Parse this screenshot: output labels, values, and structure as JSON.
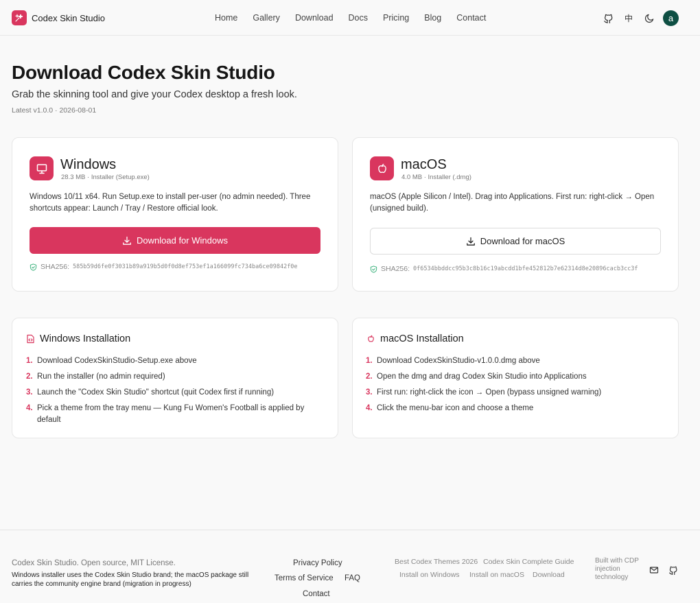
{
  "brand": {
    "name": "Codex Skin Studio"
  },
  "nav": {
    "items": [
      "Home",
      "Gallery",
      "Download",
      "Docs",
      "Pricing",
      "Blog",
      "Contact"
    ]
  },
  "header": {
    "lang_label": "中",
    "avatar_letter": "a"
  },
  "hero": {
    "title": "Download Codex Skin Studio",
    "subtitle": "Grab the skinning tool and give your Codex desktop a fresh look.",
    "latest": "Latest v1.0.0 · 2026-08-01"
  },
  "windows": {
    "name": "Windows",
    "meta": "28.3 MB · Installer (Setup.exe)",
    "desc": "Windows 10/11 x64. Run Setup.exe to install per-user (no admin needed). Three shortcuts appear: Launch / Tray / Restore official look.",
    "button": "Download for Windows",
    "sha_label": "SHA256:",
    "sha_value": "585b59d6fe0f3031b89a919b5d0f0d8ef753ef1a166099fc734ba6ce09842f0e"
  },
  "macos": {
    "name": "macOS",
    "meta": "4.0 MB · Installer (.dmg)",
    "desc": "macOS (Apple Silicon / Intel). Drag into Applications. First run: right-click → Open (unsigned build).",
    "button": "Download for macOS",
    "sha_label": "SHA256:",
    "sha_value": "0f6534bbddcc95b3c8b16c19abcdd1bfe452812b7e62314d8e20896cacb3cc3f"
  },
  "win_install": {
    "title": "Windows Installation",
    "steps": [
      {
        "num": "1.",
        "text": "Download CodexSkinStudio-Setup.exe above"
      },
      {
        "num": "2.",
        "text": "Run the installer (no admin required)"
      },
      {
        "num": "3.",
        "text": "Launch the \"Codex Skin Studio\" shortcut (quit Codex first if running)"
      },
      {
        "num": "4.",
        "text": "Pick a theme from the tray menu — Kung Fu Women's Football is applied by default"
      }
    ]
  },
  "mac_install": {
    "title": "macOS Installation",
    "steps": [
      {
        "num": "1.",
        "text": "Download CodexSkinStudio-v1.0.0.dmg above"
      },
      {
        "num": "2.",
        "text": "Open the dmg and drag Codex Skin Studio into Applications"
      },
      {
        "num": "3.",
        "text": "First run: right-click the icon → Open (bypass unsigned warning)"
      },
      {
        "num": "4.",
        "text": "Click the menu-bar icon and choose a theme"
      }
    ]
  },
  "footer": {
    "license": "Codex Skin Studio. Open source, MIT License.",
    "note": "Windows installer uses the Codex Skin Studio brand; the macOS package still carries the community engine brand (migration in progress)",
    "privacy": "Privacy Policy",
    "terms": "Terms of Service",
    "faq": "FAQ",
    "contact": "Contact",
    "best_themes": "Best Codex Themes 2026",
    "complete_guide": "Codex Skin Complete Guide",
    "install_windows": "Install on Windows",
    "install_macos": "Install on macOS",
    "download": "Download",
    "built_with": "Built with CDP injection technology"
  },
  "colors": {
    "accent": "#d9365e",
    "avatar": "#0e4f43",
    "sha_check": "#3fb37f"
  }
}
